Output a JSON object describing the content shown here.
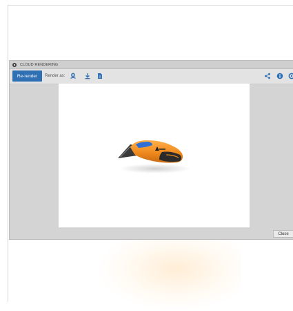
{
  "dialog": {
    "title": "CLOUD RENDERING"
  },
  "toolbar": {
    "rerender_label": "Re-render",
    "render_as_label": "Render as:",
    "render_as_options": [
      "render-icon",
      "download-icon",
      "document-icon"
    ],
    "right_actions": [
      "share-icon",
      "info-icon",
      "settings-icon"
    ]
  },
  "footer": {
    "close_label": "Close"
  },
  "preview": {
    "subject": "utility-knife-render",
    "colors": {
      "body": "#f08a1e",
      "grip": "#2b2b2b",
      "accent": "#2f6fd6",
      "blade": "#3a3a3a"
    }
  },
  "colors": {
    "primary_button": "#2f6fb3",
    "icon": "#2f6fb3"
  }
}
